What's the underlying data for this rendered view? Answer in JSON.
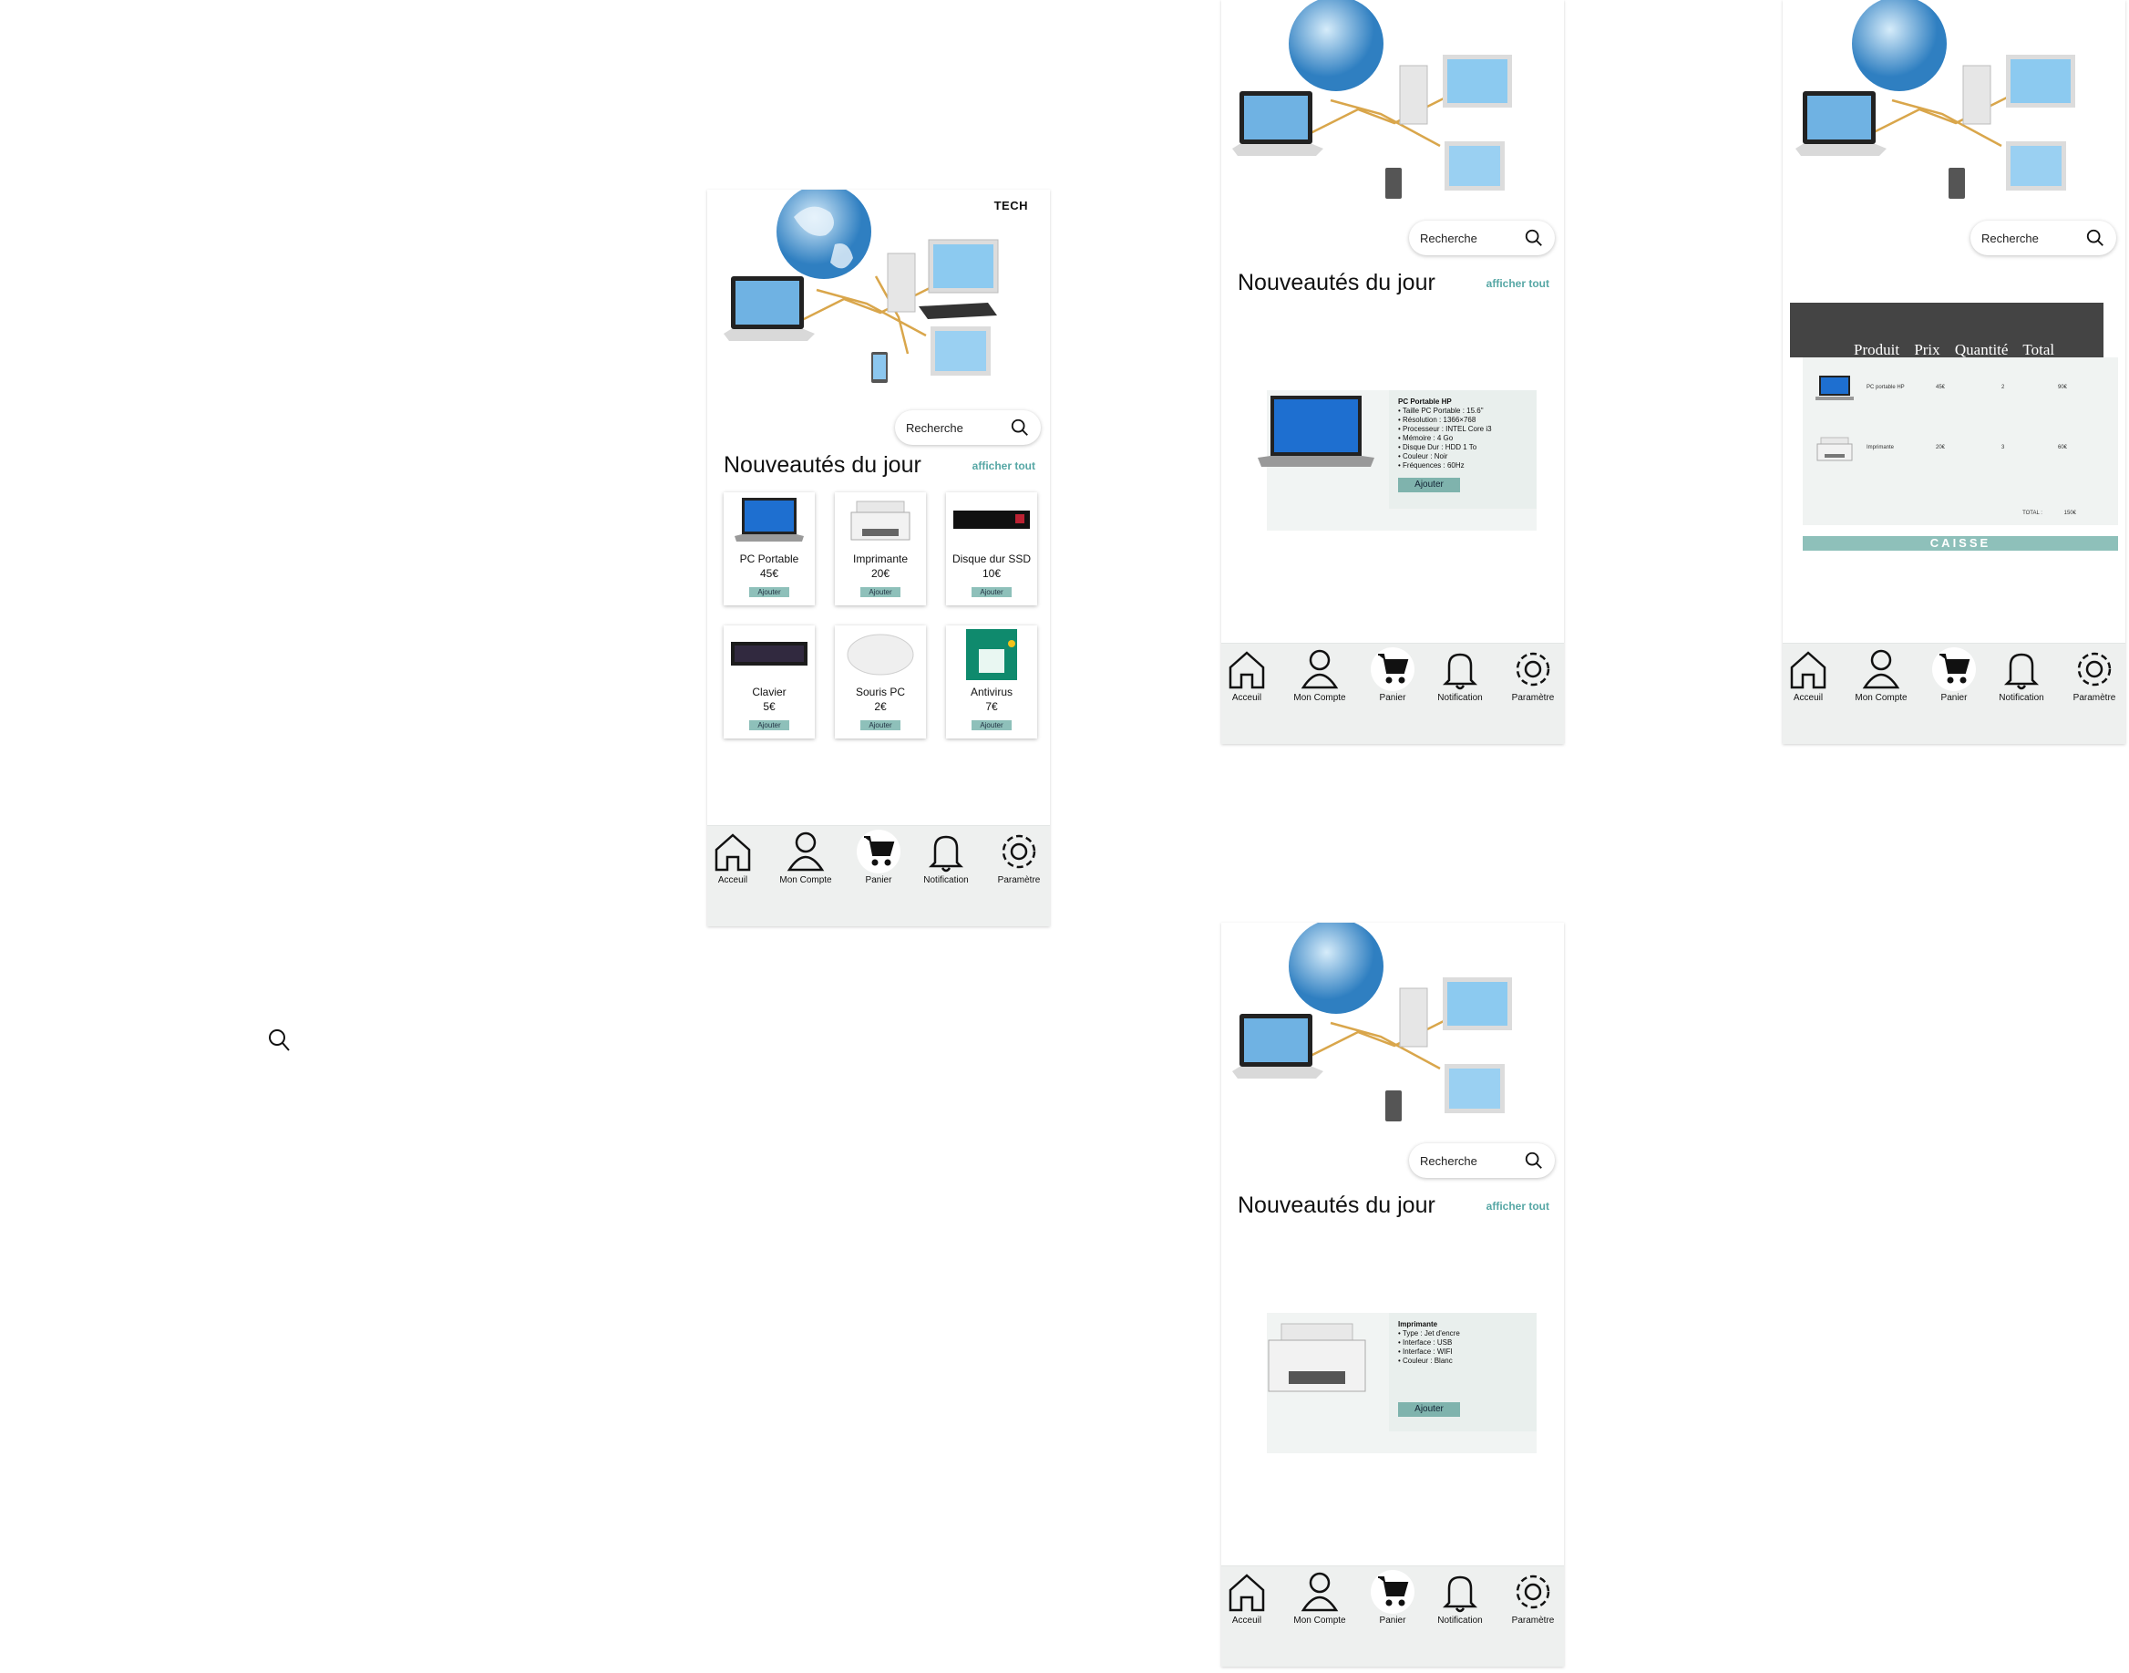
{
  "brand": "TECH",
  "search": {
    "placeholder": "Recherche"
  },
  "section": {
    "title": "Nouveautés du jour",
    "see_all": "afficher tout"
  },
  "products": [
    {
      "name": "PC Portable",
      "price": "45€",
      "add": "Ajouter"
    },
    {
      "name": "Imprimante",
      "price": "20€",
      "add": "Ajouter"
    },
    {
      "name": "Disque dur SSD",
      "price": "10€",
      "add": "Ajouter"
    },
    {
      "name": "Clavier",
      "price": "5€",
      "add": "Ajouter"
    },
    {
      "name": "Souris PC",
      "price": "2€",
      "add": "Ajouter"
    },
    {
      "name": "Antivirus",
      "price": "7€",
      "add": "Ajouter"
    }
  ],
  "nav": {
    "home": "Acceuil",
    "account": "Mon Compte",
    "cart": "Panier",
    "notification": "Notification",
    "settings": "Paramètre"
  },
  "detail_laptop": {
    "title": "PC Portable HP",
    "specs": [
      "Taille PC Portable : 15.6\"",
      "Résolution : 1366×768",
      "Processeur : INTEL Core i3",
      "Mémoire : 4 Go",
      "Disque Dur : HDD 1 To",
      "Couleur : Noir",
      "Fréquences : 60Hz"
    ],
    "add": "Ajouter"
  },
  "detail_printer": {
    "title": "Imprimante",
    "specs": [
      "Type : Jet d'encre",
      "Interface : USB",
      "Interface : WIFI",
      "Couleur : Blanc"
    ],
    "add": "Ajouter"
  },
  "cart": {
    "columns": [
      "Produit",
      "Prix",
      "Quantité",
      "Total"
    ],
    "rows": [
      {
        "product": "PC portable HP",
        "price": "45€",
        "qty": "2",
        "total": "90€"
      },
      {
        "product": "Imprimante",
        "price": "20€",
        "qty": "3",
        "total": "60€"
      }
    ],
    "total_label": "TOTAL :",
    "total_value": "150€",
    "checkout": "CAISSE"
  },
  "colors": {
    "accent": "#56a7a5",
    "button": "#8ec0ba",
    "nav_bg": "#eef0ef",
    "cart_header": "#444444"
  }
}
